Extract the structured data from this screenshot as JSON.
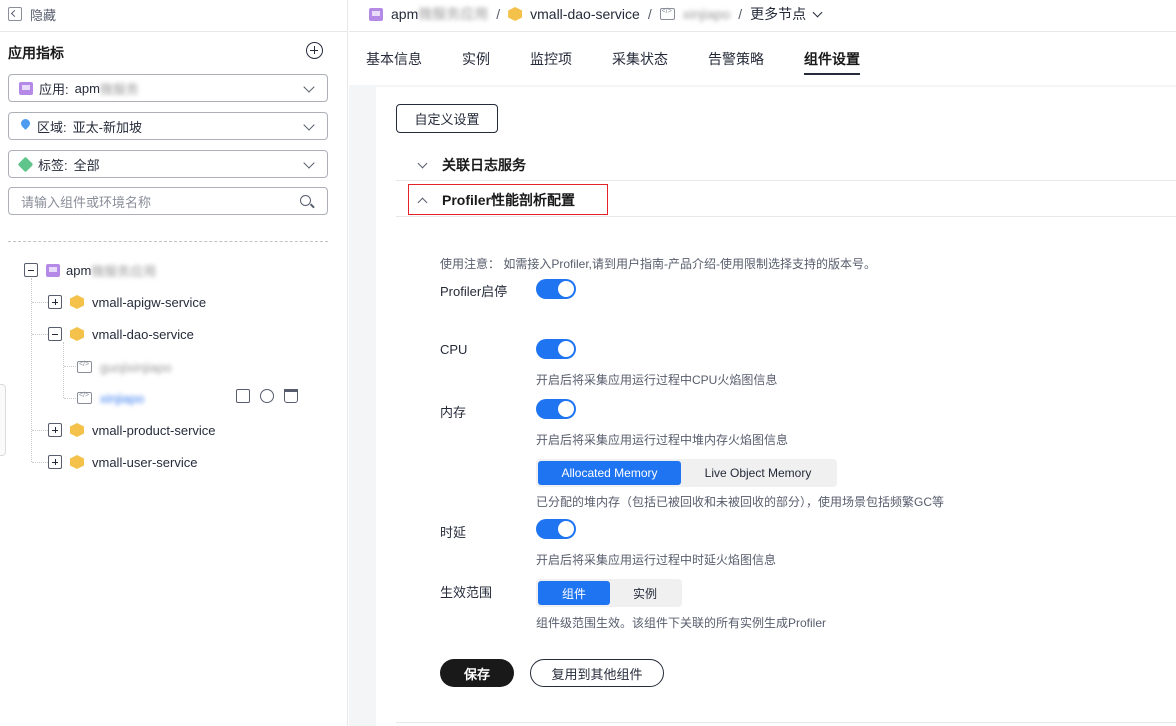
{
  "sidebar": {
    "hide_label": "隐藏",
    "section_title": "应用指标",
    "filters": [
      {
        "label": "应用:",
        "value": "apm",
        "value_blurred": "微服务",
        "icon": "app-icon"
      },
      {
        "label": "区域:",
        "value": "亚太-新加坡",
        "icon": "location-icon"
      },
      {
        "label": "标签:",
        "value": "全部",
        "icon": "tag-icon"
      }
    ],
    "search_placeholder": "请输入组件或环境名称",
    "tree": {
      "root": {
        "label": "apm",
        "label_blurred": "微服务应用"
      },
      "children": [
        {
          "label": "vmall-apigw-service",
          "expanded": false
        },
        {
          "label": "vmall-dao-service",
          "expanded": true,
          "envs": [
            {
              "label": "guojixinjiapo",
              "selected": false
            },
            {
              "label": "xinjiapo",
              "selected": true
            }
          ]
        },
        {
          "label": "vmall-product-service",
          "expanded": false
        },
        {
          "label": "vmall-user-service",
          "expanded": false
        }
      ]
    }
  },
  "breadcrumb": {
    "app": "apm",
    "app_blurred": "微服务应用",
    "service": "vmall-dao-service",
    "env_blurred": "xinjiapo",
    "more": "更多节点",
    "separator": "/"
  },
  "tabs": [
    "基本信息",
    "实例",
    "监控项",
    "采集状态",
    "告警策略",
    "组件设置"
  ],
  "active_tab": "组件设置",
  "settings": {
    "custom_button": "自定义设置",
    "section_log": "关联日志服务",
    "section_profiler": "Profiler性能剖析配置",
    "note": "使用注意：  如需接入Profiler,请到用户指南-产品介绍-使用限制选择支持的版本号。",
    "profiler_toggle_label": "Profiler启停",
    "cpu_label": "CPU",
    "cpu_help": "开启后将采集应用运行过程中CPU火焰图信息",
    "memory_label": "内存",
    "memory_help": "开启后将采集应用运行过程中堆内存火焰图信息",
    "memory_options": [
      "Allocated Memory",
      "Live Object Memory"
    ],
    "memory_selected": "Allocated Memory",
    "memory_option_help": "已分配的堆内存（包括已被回收和未被回收的部分），使用场景包括频繁GC等",
    "latency_label": "时延",
    "latency_help": "开启后将采集应用运行过程中时延火焰图信息",
    "scope_label": "生效范围",
    "scope_options": [
      "组件",
      "实例"
    ],
    "scope_selected": "组件",
    "scope_help": "组件级范围生效。该组件下关联的所有实例生成Profiler",
    "save": "保存",
    "copy": "复用到其他组件"
  },
  "colors": {
    "accent": "#1f74f2",
    "highlight_border": "#e5222a",
    "dark_button": "#191919"
  }
}
